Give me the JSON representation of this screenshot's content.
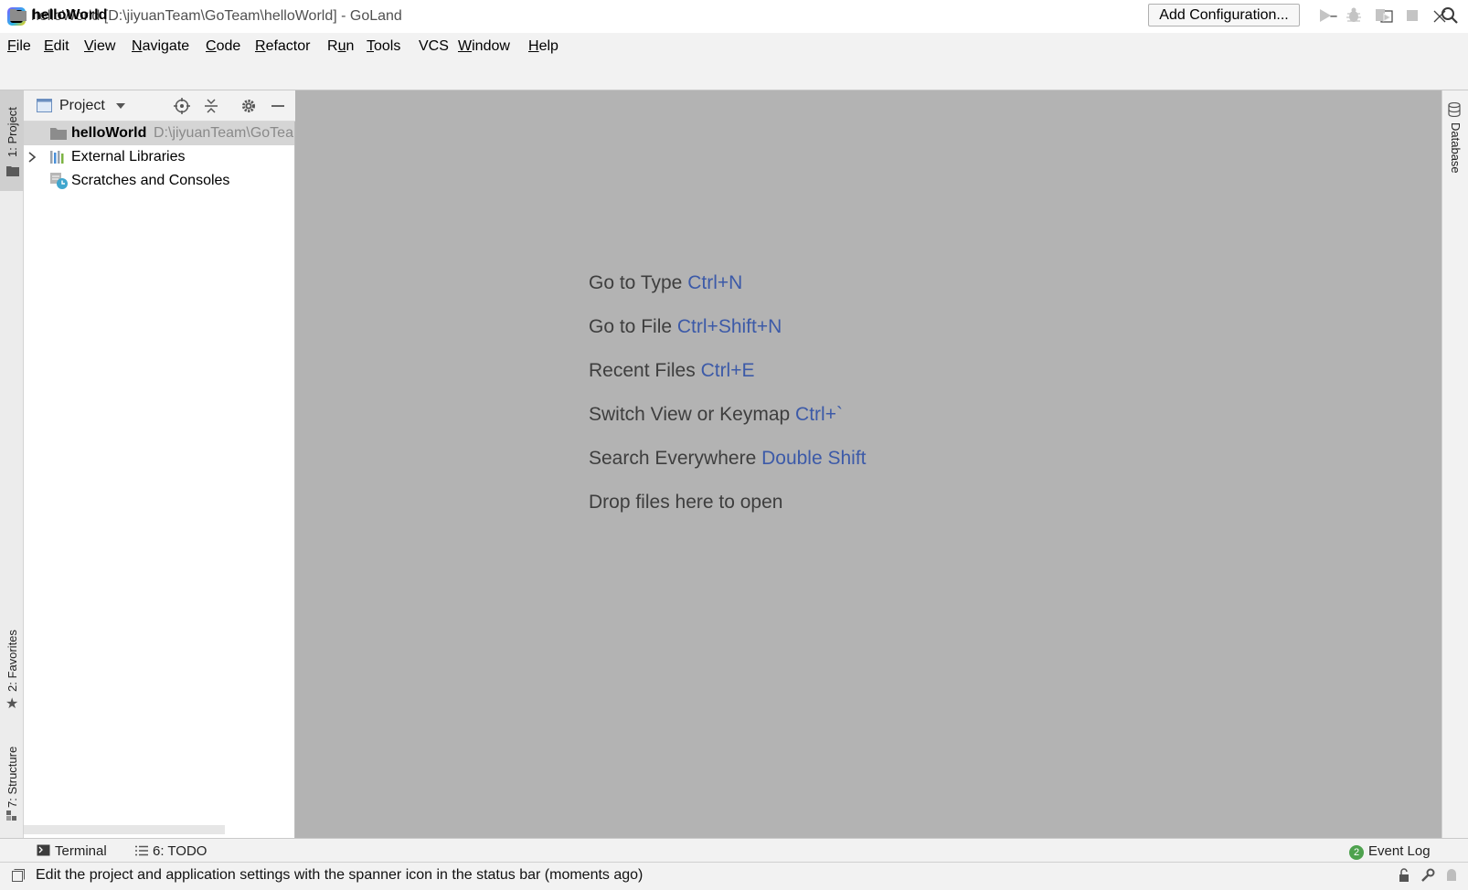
{
  "window": {
    "title": "helloWorld [D:\\jiyuanTeam\\GoTeam\\helloWorld] - GoLand",
    "minimize_icon": "minimize-icon",
    "maximize_icon": "maximize-icon",
    "close_icon": "close-icon"
  },
  "menu": [
    {
      "label": "File",
      "mnemonic": "F",
      "rest": "ile"
    },
    {
      "label": "Edit",
      "mnemonic": "E",
      "rest": "dit"
    },
    {
      "label": "View",
      "mnemonic": "V",
      "rest": "iew"
    },
    {
      "label": "Navigate",
      "mnemonic": "N",
      "rest": "avigate"
    },
    {
      "label": "Code",
      "mnemonic": "C",
      "rest": "ode"
    },
    {
      "label": "Refactor",
      "mnemonic": "R",
      "rest": "efactor"
    },
    {
      "label": "Run",
      "pre": "R",
      "mnemonic": "u",
      "rest": "n"
    },
    {
      "label": "Tools",
      "mnemonic": "T",
      "rest": "ools"
    },
    {
      "label": "VCS",
      "mnemonic": "",
      "rest": "VCS"
    },
    {
      "label": "Window",
      "mnemonic": "W",
      "rest": "indow"
    },
    {
      "label": "Help",
      "mnemonic": "H",
      "rest": "elp"
    }
  ],
  "navbar": {
    "breadcrumb": "helloWorld",
    "add_configuration": "Add Configuration..."
  },
  "left_stripe": {
    "project_tab": "1: Project",
    "favorites_tab": "2: Favorites",
    "structure_tab": "7: Structure"
  },
  "right_stripe": {
    "database_tab": "Database"
  },
  "project_panel": {
    "title": "Project",
    "tree": [
      {
        "label": "helloWorld",
        "path": "D:\\jiyuanTeam\\GoTeam\\helloWorld",
        "selected": true
      },
      {
        "label": "External Libraries",
        "expandable": true
      },
      {
        "label": "Scratches and Consoles"
      }
    ]
  },
  "editor": {
    "hints": [
      {
        "text": "Go to Type",
        "shortcut": "Ctrl+N"
      },
      {
        "text": "Go to File",
        "shortcut": "Ctrl+Shift+N"
      },
      {
        "text": "Recent Files",
        "shortcut": "Ctrl+E"
      },
      {
        "text": "Switch View or Keymap",
        "shortcut": "Ctrl+`"
      },
      {
        "text": "Search Everywhere",
        "shortcut": "Double Shift"
      },
      {
        "text": "Drop files here to open",
        "shortcut": ""
      }
    ]
  },
  "bottom_bar": {
    "terminal": "Terminal",
    "todo": "6: TODO",
    "event_log": "Event Log",
    "event_count": "2"
  },
  "status": {
    "message": "Edit the project and application settings with the spanner icon in the status bar (moments ago)"
  },
  "colors": {
    "editor_bg": "#b3b3b3",
    "shortcut": "#3c5aa8",
    "badge": "#4ea24e"
  }
}
